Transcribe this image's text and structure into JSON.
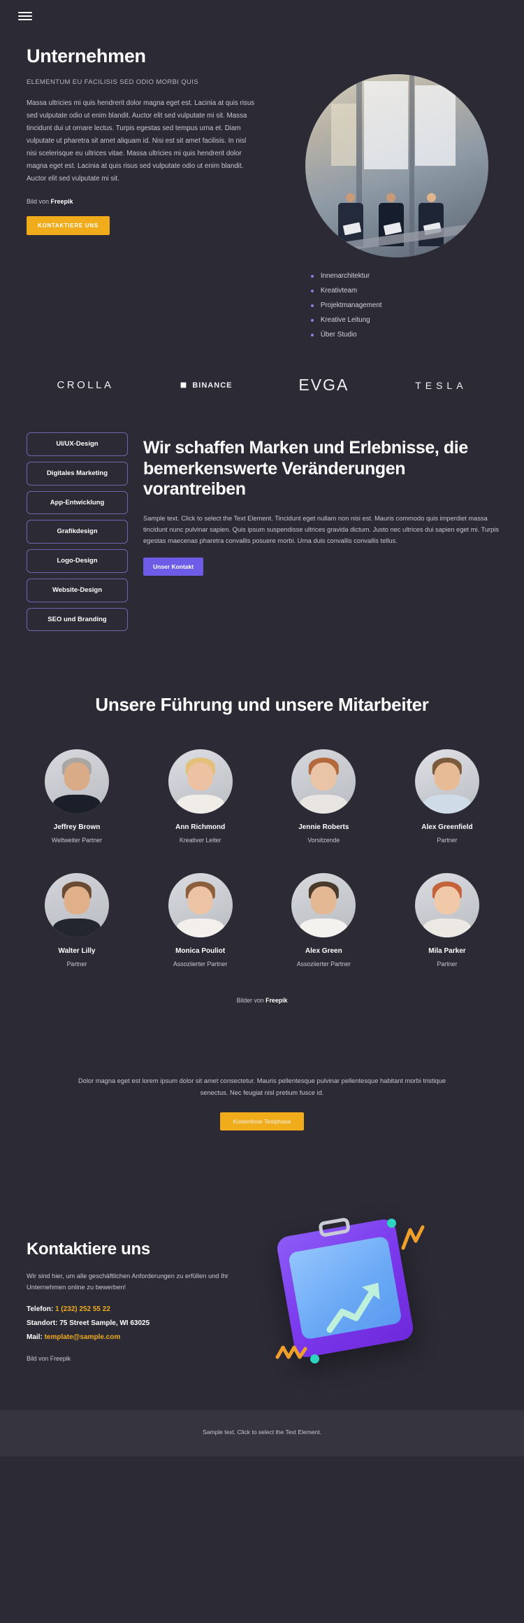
{
  "header": {
    "menu_icon": "hamburger-menu-icon"
  },
  "hero": {
    "title": "Unternehmen",
    "subtitle": "ELEMENTUM EU FACILISIS SED ODIO MORBI QUIS",
    "body": "Massa ultricies mi quis hendrerit dolor magna eget est. Lacinia at quis risus sed vulputate odio ut enim blandit. Auctor elit sed vulputate mi sit. Massa tincidunt dui ut ornare lectus. Turpis egestas sed tempus urna et. Diam vulputate ut pharetra sit amet aliquam id. Nisi est sit amet facilisis. In nisl nisi scelerisque eu ultrices vitae. Massa ultricies mi quis hendrerit dolor magna eget est. Lacinia at quis risus sed vulputate odio ut enim blandit. Auctor elit sed vulputate mi sit.",
    "credit_prefix": "Bild von ",
    "credit_brand": "Freepik",
    "cta_label": "KONTAKTIERE UNS",
    "photo_alt": "team-meeting-photo",
    "bullets": [
      "Innenarchitektur",
      "Kreativteam",
      "Projektmanagement",
      "Kreative Leitung",
      "Über Studio"
    ]
  },
  "logos": [
    {
      "name": "CROLLA",
      "key": "crolla"
    },
    {
      "name": "BINANCE",
      "key": "binance"
    },
    {
      "name": "EVGA",
      "key": "evga"
    },
    {
      "name": "TESLA",
      "key": "tesla"
    }
  ],
  "services": {
    "tags": [
      "UI/UX-Design",
      "Digitales Marketing",
      "App-Entwicklung",
      "Grafikdesign",
      "Logo-Design",
      "Website-Design",
      "SEO und Branding"
    ],
    "title": "Wir schaffen Marken und Erlebnisse, die bemerkenswerte Veränderungen vorantreiben",
    "body": "Sample text. Click to select the Text Element. Tincidunt eget nullam non nisi est. Mauris commodo quis imperdiet massa tincidunt nunc pulvinar sapien. Quis ipsum suspendisse ultrices gravida dictum. Justo nec ultrices dui sapien eget mi. Turpis egestas maecenas pharetra convallis posuere morbi. Urna duis convallis convallis tellus.",
    "cta_label": "Unser Kontakt"
  },
  "team": {
    "title": "Unsere Führung und unsere Mitarbeiter",
    "credit_prefix": "Bilder von ",
    "credit_brand": "Freepik",
    "members": [
      {
        "name": "Jeffrey Brown",
        "role": "Weltweiter Partner",
        "skin": "#d9ab86",
        "hair": "#a9a6a3",
        "cloth": "#1b1f2a",
        "bg": "#d7d9dd"
      },
      {
        "name": "Ann Richmond",
        "role": "Kreativer Leiter",
        "skin": "#ecc2a2",
        "hair": "#e3c07a",
        "cloth": "#f0ece8",
        "bg": "#dcdee2"
      },
      {
        "name": "Jennie Roberts",
        "role": "Vorsitzende",
        "skin": "#eac4a6",
        "hair": "#b3693c",
        "cloth": "#e8e5e2",
        "bg": "#d5d7db"
      },
      {
        "name": "Alex Greenfield",
        "role": "Partner",
        "skin": "#e8bb97",
        "hair": "#7c5a3c",
        "cloth": "#cfdbe6",
        "bg": "#dfe1e5"
      },
      {
        "name": "Walter Lilly",
        "role": "Partner",
        "skin": "#e0b089",
        "hair": "#6b4a33",
        "cloth": "#23262f",
        "bg": "#d2d4d9"
      },
      {
        "name": "Monica Pouliot",
        "role": "Assoziierter Partner",
        "skin": "#ecc3a4",
        "hair": "#8b5e3c",
        "cloth": "#f2efec",
        "bg": "#d9dbdf"
      },
      {
        "name": "Alex Green",
        "role": "Assoziierter Partner",
        "skin": "#e3b892",
        "hair": "#4a3a2c",
        "cloth": "#f4f2ef",
        "bg": "#d6d8dc"
      },
      {
        "name": "Mila Parker",
        "role": "Partner",
        "skin": "#f0c9a9",
        "hair": "#c4633a",
        "cloth": "#ece9e5",
        "bg": "#dadce0"
      }
    ]
  },
  "trial": {
    "body": "Dolor magna eget est lorem ipsum dolor sit amet consectetur. Mauris pellentesque pulvinar pellentesque habitant morbi tristique senectus. Nec feugiat nisl pretium fusce id.",
    "cta_label": "Kostenlose Testphase"
  },
  "contact": {
    "title": "Kontaktiere uns",
    "lead": "Wir sind hier, um alle geschäftlichen Anforderungen zu erfüllen und Ihr Unternehmen online zu bewerben!",
    "phone_label": "Telefon: ",
    "phone_value": "1 (232) 252 55 22",
    "location_label": "Standort: ",
    "location_value": "75 Street Sample, WI 63025",
    "mail_label": "Mail: ",
    "mail_value": "template@sample.com",
    "credit": "Bild von Freepik",
    "art_alt": "clipboard-chart-illustration"
  },
  "footer": {
    "text": "Sample text. Click to select the Text Element."
  },
  "colors": {
    "background": "#2b2a35",
    "accent_yellow": "#f0ac1b",
    "accent_purple": "#6c5ce7",
    "tag_border": "#6f66ad",
    "footer_bg": "#35343f"
  }
}
